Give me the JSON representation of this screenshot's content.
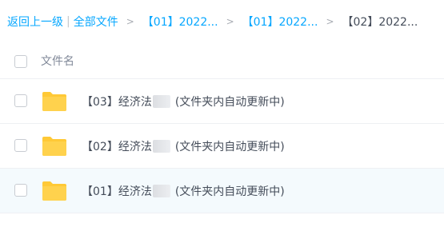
{
  "breadcrumb": {
    "back": "返回上一级",
    "separator": "|",
    "all_files": "全部文件",
    "crumb1": "【01】2022...",
    "crumb2": "【01】2022...",
    "current": "【02】2022...",
    "chevron": ">"
  },
  "table": {
    "header": "文件名",
    "rows": [
      {
        "name_prefix": "【03】经济法",
        "name_suffix": "(文件夹内自动更新中)"
      },
      {
        "name_prefix": "【02】经济法",
        "name_suffix": "(文件夹内自动更新中)"
      },
      {
        "name_prefix": "【01】经济法",
        "name_suffix": "(文件夹内自动更新中)"
      }
    ]
  },
  "colors": {
    "link": "#06a7ff",
    "folder": "#ffc936",
    "row_highlight": "#f4fafd"
  },
  "icons": {
    "row_icon": "folder-icon"
  }
}
